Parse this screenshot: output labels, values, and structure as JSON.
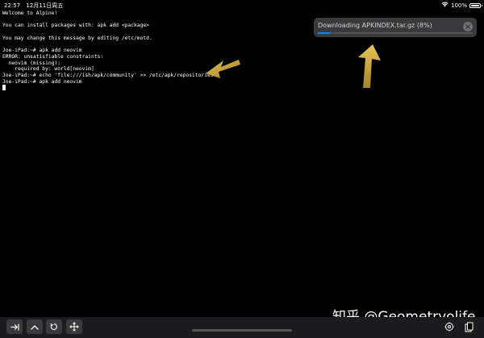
{
  "status_bar": {
    "time": "22:57",
    "date": "12月11日周五",
    "battery": "100%",
    "wifi_icon": "wifi-icon",
    "battery_icon": "battery-icon"
  },
  "terminal": {
    "lines": [
      "Welcome to Alpine!",
      "",
      "You can install packages with: apk add <package>",
      "",
      "You may change this message by editing /etc/motd.",
      "",
      "Joe-iPad:~# apk add neovim",
      "ERROR: unsatisfiable constraints:",
      "  neovim (missing):",
      "    required by: world[neovim]",
      "Joe-iPad:~# echo 'file:///ish/apk/community' >> /etc/apk/repositories",
      "Joe-iPad:~# apk add neovim"
    ]
  },
  "download": {
    "text": "Downloading APKINDEX.tar.gz (8%)",
    "progress": 0.08,
    "close_icon": "close-icon"
  },
  "watermark": {
    "text": "知乎 @Geometryolife"
  },
  "toolbar": {
    "buttons": [
      {
        "name": "tab-key-button",
        "icon": "tab-arrow-icon"
      },
      {
        "name": "control-key-button",
        "icon": "caret-up-icon"
      },
      {
        "name": "escape-key-button",
        "icon": "rotate-icon"
      },
      {
        "name": "arrow-keys-button",
        "icon": "move-arrows-icon"
      }
    ],
    "right_icons": [
      "settings-icon",
      "paste-icon"
    ]
  },
  "colors": {
    "background": "#000000",
    "terminal_text": "#ffffff",
    "banner_bg": "#3a3a3c",
    "progress": "#0a84ff",
    "annotation": "#d4b13a",
    "toolbar_bg": "#1c1c1e"
  }
}
